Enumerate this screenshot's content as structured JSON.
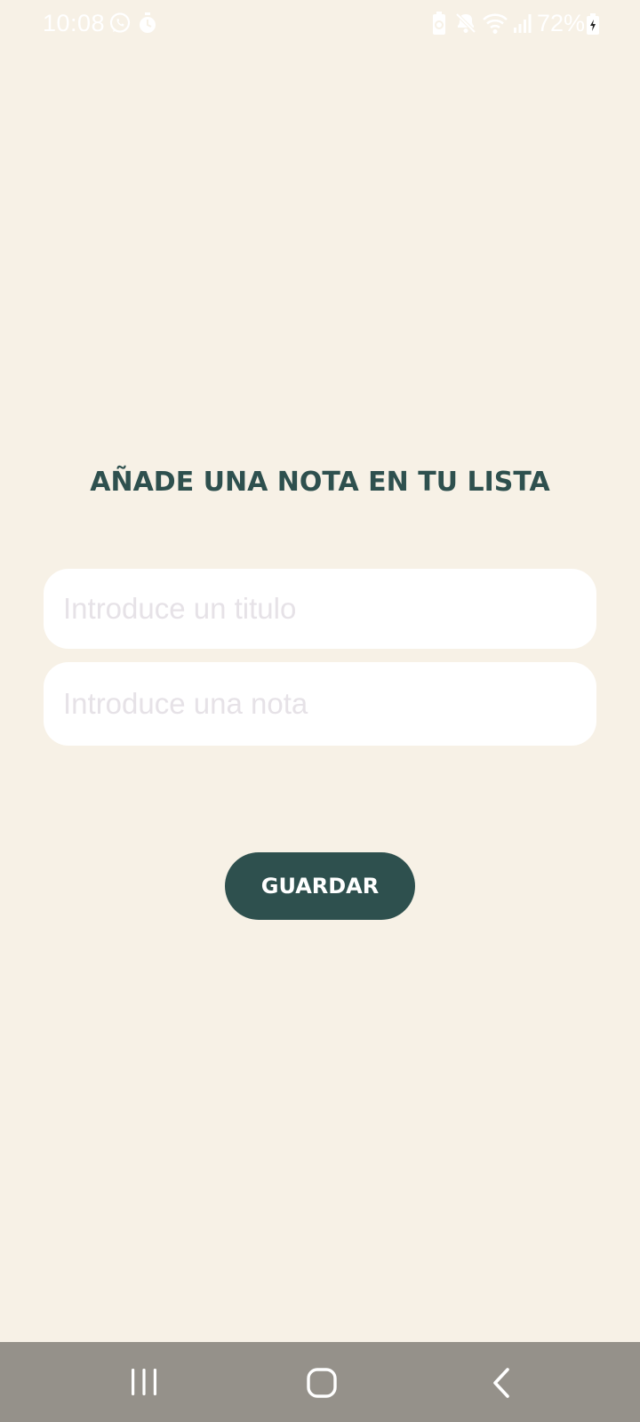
{
  "status_bar": {
    "time": "10:08",
    "battery_percent": "72%",
    "icons": [
      "whatsapp-icon",
      "timer-icon",
      "battery-saver-icon",
      "mute-icon",
      "wifi-icon",
      "signal-icon",
      "battery-icon"
    ]
  },
  "form": {
    "heading": "AÑADE UNA NOTA EN TU LISTA",
    "title_input": {
      "placeholder": "Introduce un titulo",
      "value": ""
    },
    "note_input": {
      "placeholder": "Introduce una nota",
      "value": ""
    },
    "save_label": "GUARDAR"
  },
  "navigation": {
    "items": [
      "recent-apps-icon",
      "home-icon",
      "back-icon"
    ]
  },
  "colors": {
    "background": "#F7F1E6",
    "accent": "#2E504E",
    "input_background": "#FFFFFF",
    "placeholder": "#E6E2E7",
    "nav_bar": "#95918A"
  }
}
